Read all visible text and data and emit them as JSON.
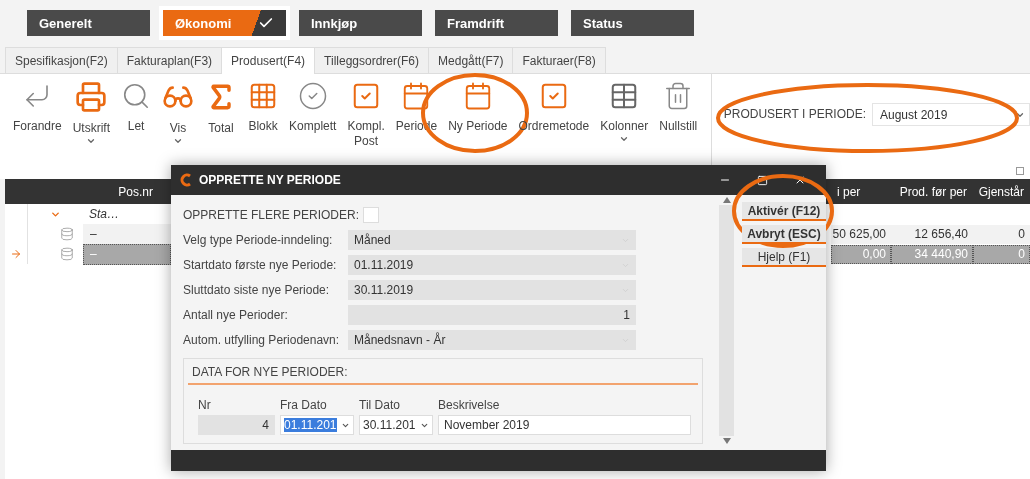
{
  "modules": [
    {
      "label": "Generelt",
      "selected": false
    },
    {
      "label": "Økonomi",
      "selected": true
    },
    {
      "label": "Innkjøp",
      "selected": false
    },
    {
      "label": "Framdrift",
      "selected": false
    },
    {
      "label": "Status",
      "selected": false
    }
  ],
  "tabs": [
    {
      "label": "Spesifikasjon(F2)",
      "selected": false
    },
    {
      "label": "Fakturaplan(F3)",
      "selected": false
    },
    {
      "label": "Produsert(F4)",
      "selected": true
    },
    {
      "label": "Tilleggsordrer(F6)",
      "selected": false
    },
    {
      "label": "Medgått(F7)",
      "selected": false
    },
    {
      "label": "Fakturaer(F8)",
      "selected": false
    }
  ],
  "toolbar": {
    "tools": [
      {
        "label": "Forandre",
        "dropdown": false,
        "circled": false
      },
      {
        "label": "Utskrift",
        "dropdown": true,
        "circled": false
      },
      {
        "label": "Let",
        "dropdown": false,
        "circled": false
      },
      {
        "label": "Vis",
        "dropdown": true,
        "circled": false
      },
      {
        "label": "Total",
        "dropdown": false,
        "circled": false
      },
      {
        "label": "Blokk",
        "dropdown": false,
        "circled": false
      },
      {
        "label": "Komplett",
        "dropdown": false,
        "circled": false
      },
      {
        "label": "Kompl.\nPost",
        "dropdown": false,
        "circled": false
      },
      {
        "label": "Periode",
        "dropdown": false,
        "circled": false
      },
      {
        "label": "Ny Periode",
        "dropdown": false,
        "circled": true
      },
      {
        "label": "Ordremetode",
        "dropdown": false,
        "circled": false
      },
      {
        "label": "Kolonner",
        "dropdown": true,
        "circled": false
      },
      {
        "label": "Nullstill",
        "dropdown": false,
        "circled": false
      }
    ]
  },
  "period_selector": {
    "label": "PRODUSERT I PERIODE:",
    "value": "August 2019",
    "circled": true
  },
  "grid": {
    "left_columns": [
      "Pos.nr"
    ],
    "right_columns": [
      "i per",
      "Prod. før per",
      "Gjenstår"
    ],
    "rows": [
      {
        "kind": "group",
        "expanded": true,
        "label": "Sta…",
        "values": []
      },
      {
        "kind": "item",
        "current": false,
        "selected": false,
        "label": "–",
        "values": [
          "50 625,00",
          "12 656,40",
          "0"
        ]
      },
      {
        "kind": "item",
        "current": true,
        "selected": true,
        "label": "–",
        "values": [
          "0,00",
          "34 440,90",
          "0"
        ]
      }
    ]
  },
  "dialog": {
    "title": "OPPRETTE NY PERIODE",
    "multi": {
      "label": "OPPRETTE FLERE PERIODER:",
      "checked": false
    },
    "fields": [
      {
        "label": "Velg type Periode-inndeling:",
        "value": "Måned",
        "kind": "select"
      },
      {
        "label": "Startdato første nye Periode:",
        "value": "01.11.2019",
        "kind": "select"
      },
      {
        "label": "Sluttdato siste nye Periode:",
        "value": "30.11.2019",
        "kind": "select"
      },
      {
        "label": "Antall nye Perioder:",
        "value": "1",
        "kind": "number"
      },
      {
        "label": "Autom. utfylling Periodenavn:",
        "value": "Månedsnavn - År",
        "kind": "select"
      }
    ],
    "data_section": {
      "title": "DATA FOR NYE PERIODER:",
      "columns": [
        "Nr",
        "Fra Dato",
        "Til Dato",
        "Beskrivelse"
      ],
      "row": {
        "nr": "4",
        "from": {
          "value": "01.11.201",
          "highlighted": true
        },
        "to": {
          "value": "30.11.201",
          "highlighted": false
        },
        "description": "November 2019"
      }
    },
    "buttons": [
      {
        "label": "Aktivér (F12)",
        "emphasis": true,
        "circled": true
      },
      {
        "label": "Avbryt (ESC)",
        "emphasis": true,
        "circled": false
      },
      {
        "label": "Hjelp (F1)",
        "emphasis": false,
        "circled": false
      }
    ]
  }
}
